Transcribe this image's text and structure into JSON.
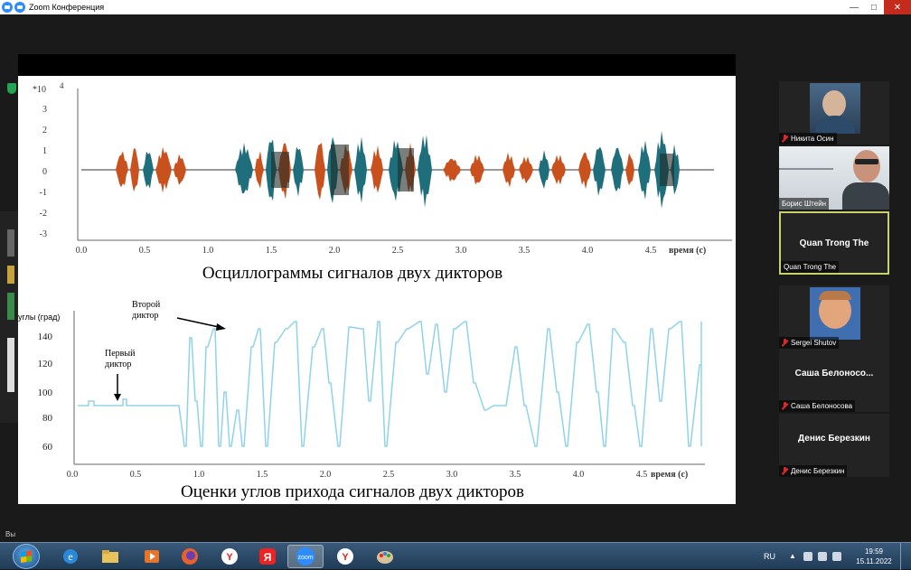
{
  "window": {
    "title": "Zoom Конференция"
  },
  "slide": {
    "chart1": {
      "exponent_label": "*10",
      "exponent_value": "4",
      "y_ticks": [
        "3",
        "2",
        "1",
        "0",
        "-1",
        "-2",
        "-3"
      ],
      "x_ticks": [
        "0.0",
        "0.5",
        "1.0",
        "1.5",
        "2.0",
        "2.5",
        "3.0",
        "3.5",
        "4.0",
        "4.5"
      ],
      "x_axis_label": "время (с)",
      "caption": "Осциллограммы сигналов двух дикторов",
      "colors": {
        "speaker1": "#c8511e",
        "speaker2": "#1e6e7c",
        "overlap": "#1e2a26"
      }
    },
    "chart2": {
      "y_axis_label": "углы (град)",
      "y_ticks": [
        "140",
        "120",
        "100",
        "80",
        "60"
      ],
      "x_ticks": [
        "0.0",
        "0.5",
        "1.0",
        "1.5",
        "2.0",
        "2.5",
        "3.0",
        "3.5",
        "4.0",
        "4.5"
      ],
      "x_axis_label": "время (с)",
      "annotation_first_line1": "Первый",
      "annotation_first_line2": "диктор",
      "annotation_second_line1": "Второй",
      "annotation_second_line2": "диктор",
      "caption": "Оценки углов прихода сигналов двух дикторов",
      "line_color": "#8fd3ea"
    }
  },
  "participants": [
    {
      "name": "Никита Осин",
      "muted": true,
      "video": true
    },
    {
      "name": "Борис Штейн",
      "muted": false,
      "video": true
    },
    {
      "name": "Quan Trong The",
      "display": "Quan Trong The",
      "muted": false,
      "video": false,
      "active": true
    },
    {
      "name": "Sergei Shutov",
      "muted": true,
      "video": true
    },
    {
      "name": "Саша Белоносова",
      "display": "Саша  Белоносо...",
      "muted": true,
      "video": false
    },
    {
      "name": "Денис Березкин",
      "display": "Денис Березкин",
      "muted": true,
      "video": false
    }
  ],
  "bottom_hint": "Вы",
  "taskbar": {
    "apps": [
      "internet-explorer",
      "file-explorer",
      "media-player",
      "firefox",
      "yandex-browser",
      "yandex",
      "zoom",
      "yandex-browser-2",
      "paint"
    ],
    "zoom_label": "zoom",
    "language": "RU",
    "time": "19:59",
    "date": "15.11.2022"
  }
}
